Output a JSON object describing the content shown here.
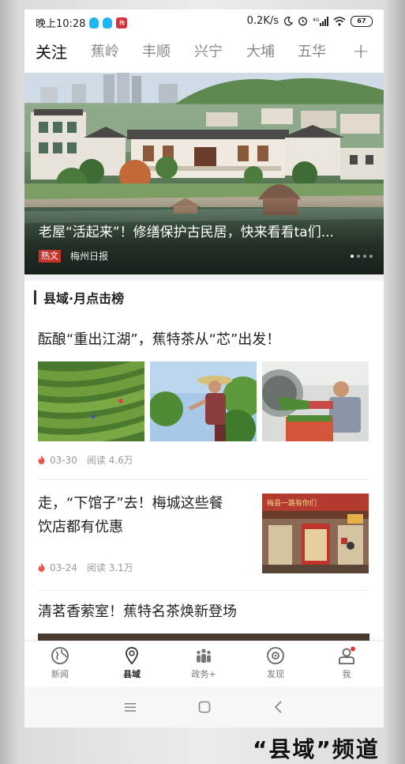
{
  "status_bar": {
    "time": "晚上10:28",
    "app_icon_text": "梅",
    "network_speed": "0.2K/s",
    "network_type": "4G",
    "battery": "67"
  },
  "tabs": [
    {
      "label": "关注",
      "active": true
    },
    {
      "label": "蕉岭",
      "active": false
    },
    {
      "label": "丰顺",
      "active": false
    },
    {
      "label": "兴宁",
      "active": false
    },
    {
      "label": "大埔",
      "active": false
    },
    {
      "label": "五华",
      "active": false
    }
  ],
  "tab_add_label": "+",
  "hero": {
    "title": "老屋“活起来”！修缮保护古民居，快来看看ta们...",
    "tag": "热文",
    "source": "梅州日报",
    "slide_count": 4,
    "slide_active": 0
  },
  "section": {
    "title": "县域·月点击榜"
  },
  "articles": [
    {
      "title": "酝酿“重出江湖”，蕉特茶从“芯”出发！",
      "date": "03-30",
      "reads": "阅读 4.6万"
    },
    {
      "title_line1": "走，“下馆子”去！梅城这些餐",
      "title_line2": "饮店都有优惠",
      "date": "03-24",
      "reads": "阅读 3.1万",
      "sign_text": "梅县一路有你们"
    },
    {
      "title": "清茗香萦室！蕉特名茶焕新登场"
    }
  ],
  "bottom_nav": [
    {
      "label": "新闻",
      "icon": "globe-icon",
      "active": false
    },
    {
      "label": "县域",
      "icon": "location-pin-icon",
      "active": true
    },
    {
      "label": "政务+",
      "icon": "people-icon",
      "active": false
    },
    {
      "label": "发现",
      "icon": "compass-icon",
      "active": false
    },
    {
      "label": "我",
      "icon": "user-icon",
      "active": false,
      "badge": true
    }
  ],
  "caption": "“县域”频道",
  "colors": {
    "accent_red": "#c8332b",
    "flame": "#e8584c",
    "badge": "#e53935"
  }
}
